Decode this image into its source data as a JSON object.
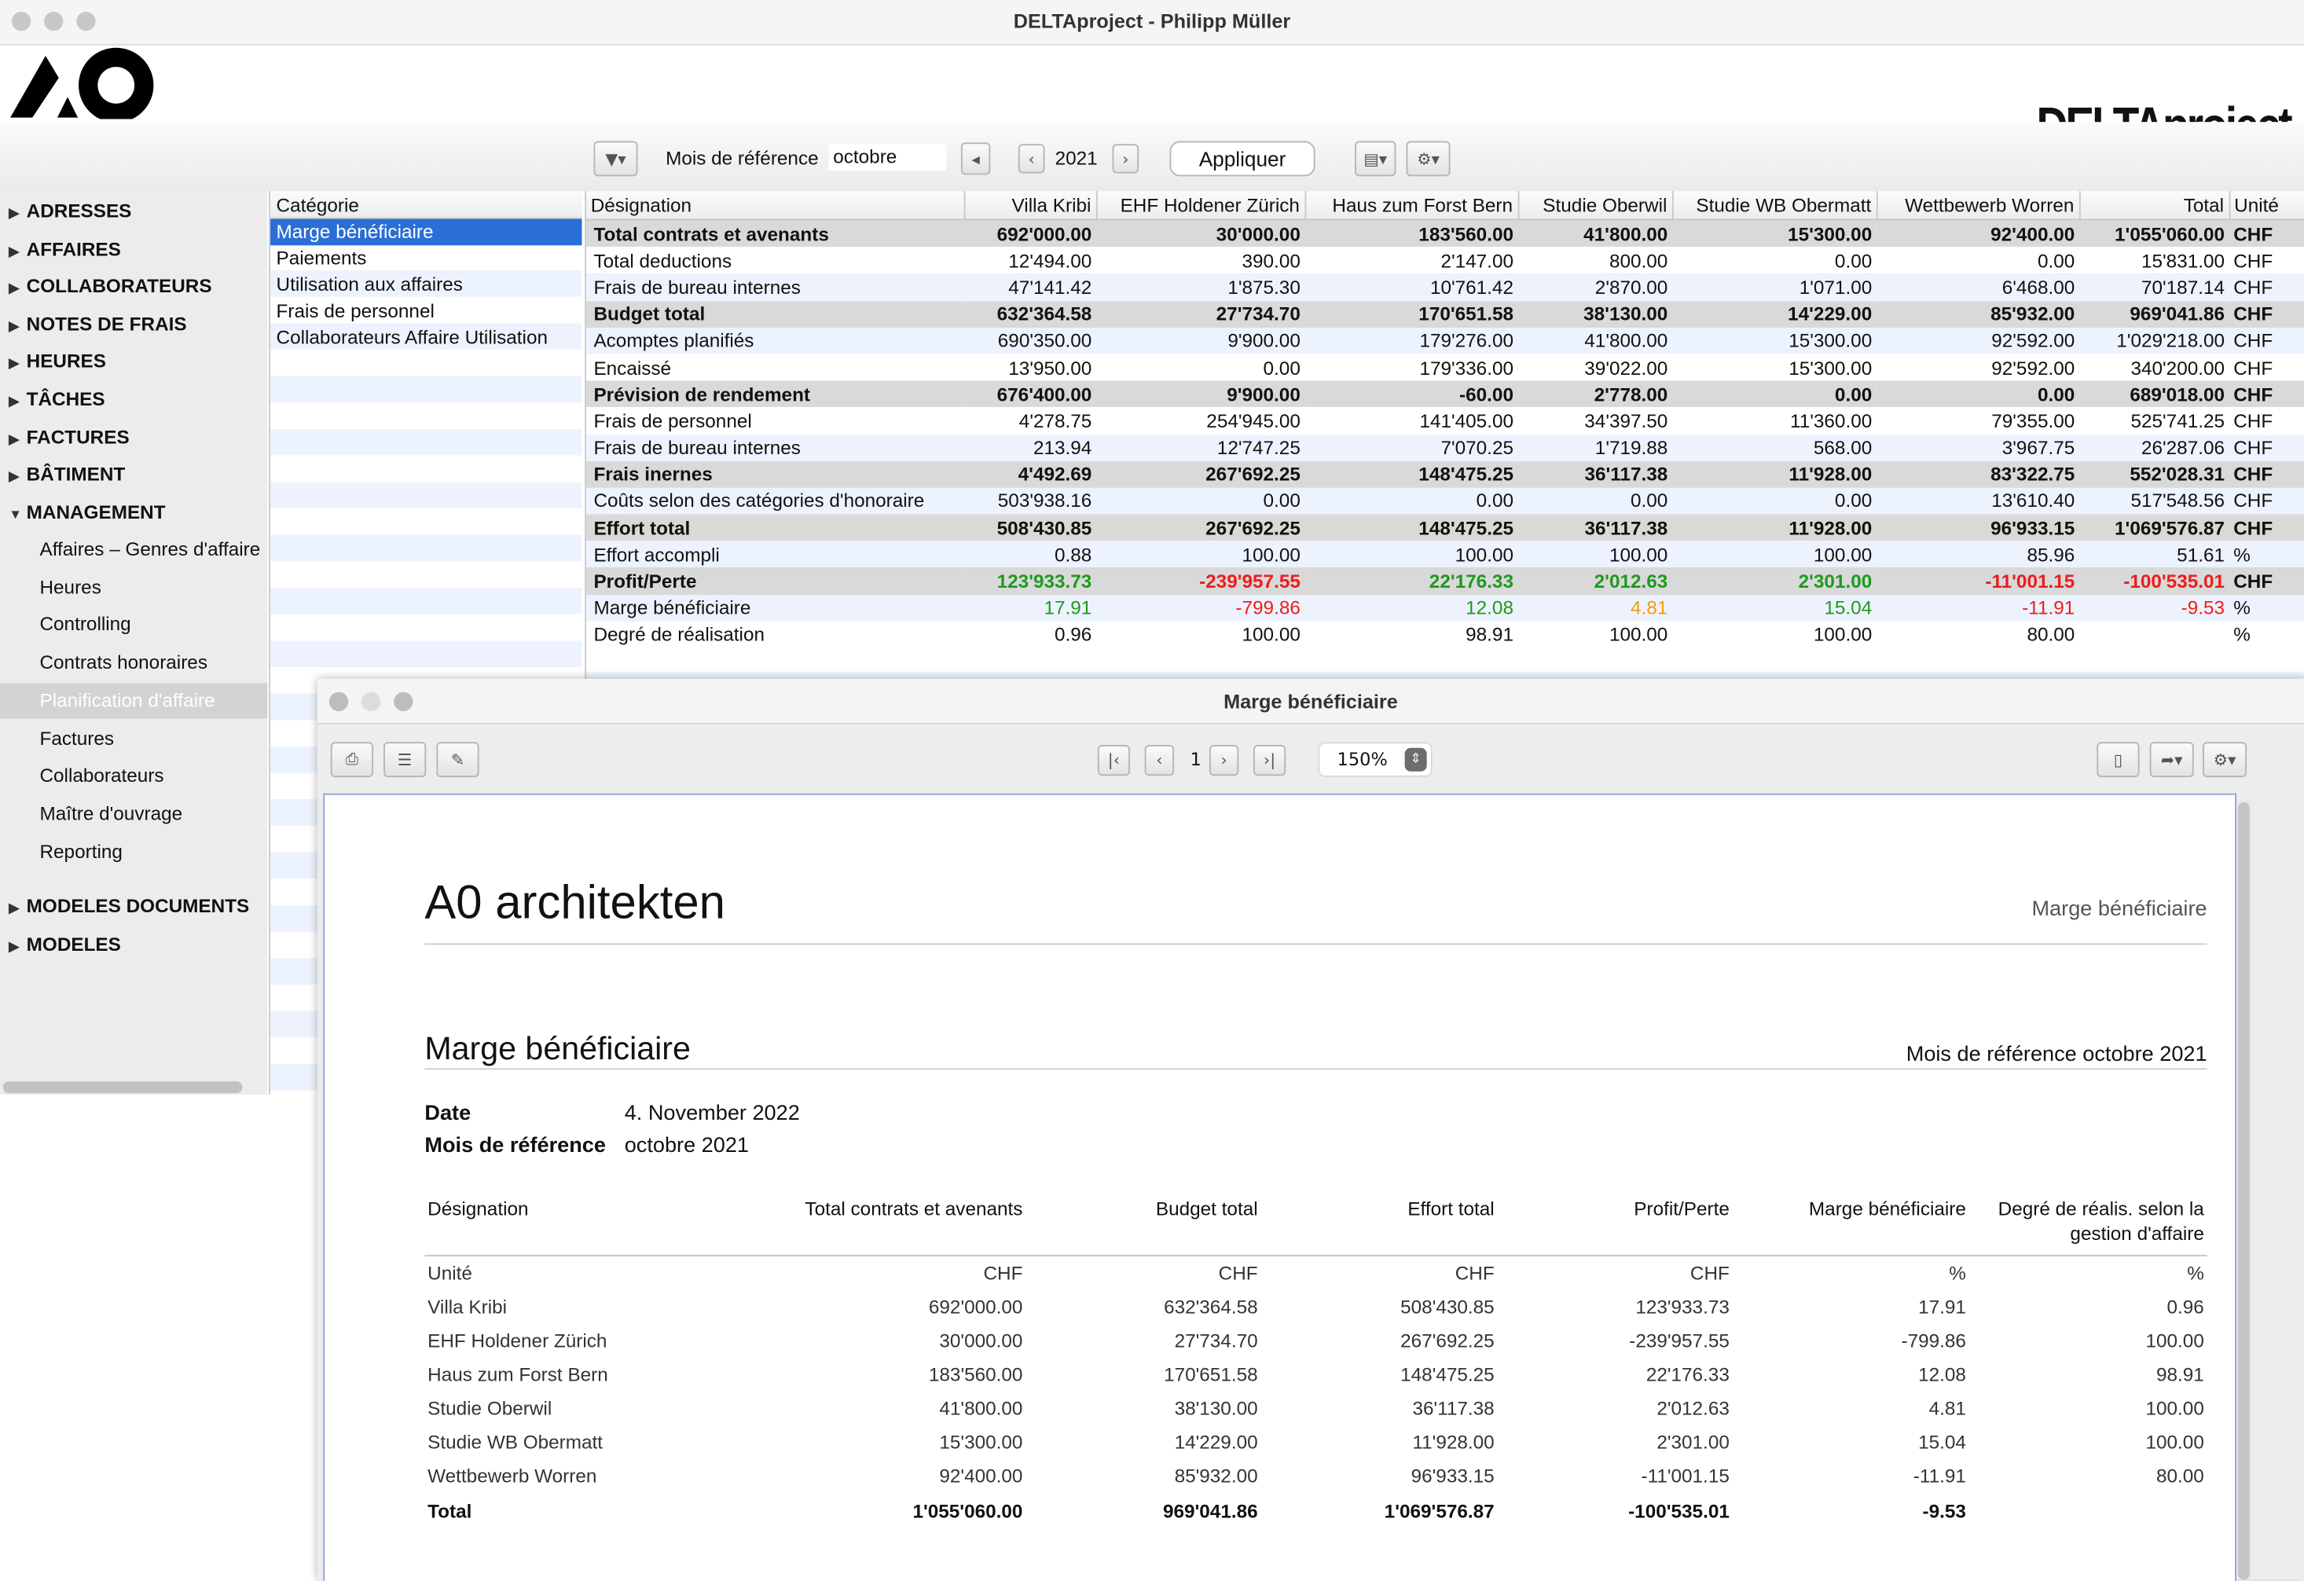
{
  "window": {
    "title": "DELTAproject - Philipp Müller",
    "brand": "DELTAproject",
    "logo": "A0"
  },
  "toolbar": {
    "filter_icon": "filter-icon",
    "ref_month_label": "Mois de référence",
    "ref_month_value": "octobre",
    "year": "2021",
    "apply_label": "Appliquer",
    "doc_icon": "document-icon",
    "gear_icon": "gear-icon"
  },
  "sidebar": {
    "top_items": [
      "ADRESSES",
      "AFFAIRES",
      "COLLABORATEURS",
      "NOTES DE FRAIS",
      "HEURES",
      "TÂCHES",
      "FACTURES",
      "BÂTIMENT"
    ],
    "expanded": "MANAGEMENT",
    "sub_items": [
      "Affaires – Genres d'affaire",
      "Heures",
      "Controlling",
      "Contrats honoraires",
      "Planification d'affaire",
      "Factures",
      "Collaborateurs",
      "Maître d'ouvrage",
      "Reporting"
    ],
    "selected_sub": "Planification d'affaire",
    "bottom_items": [
      "MODELES DOCUMENTS",
      "MODELES"
    ]
  },
  "categories": {
    "header": "Catégorie",
    "items": [
      "Marge bénéficiaire",
      "Paiements",
      "Utilisation aux affaires",
      "Frais de personnel",
      "Collaborateurs Affaire Utilisation"
    ],
    "selected": "Marge bénéficiaire"
  },
  "main_table": {
    "columns": [
      "Désignation",
      "Villa Kribi",
      "EHF Holdener Zürich",
      "Haus zum Forst Bern",
      "Studie Oberwil",
      "Studie WB Obermatt",
      "Wettbewerb Worren",
      "Total",
      "Unité"
    ],
    "rows": [
      {
        "bold": true,
        "cells": [
          "Total contrats et avenants",
          "692'000.00",
          "30'000.00",
          "183'560.00",
          "41'800.00",
          "15'300.00",
          "92'400.00",
          "1'055'060.00",
          "CHF"
        ]
      },
      {
        "cells": [
          "Total deductions",
          "12'494.00",
          "390.00",
          "2'147.00",
          "800.00",
          "0.00",
          "0.00",
          "15'831.00",
          "CHF"
        ]
      },
      {
        "cells": [
          "Frais de bureau internes",
          "47'141.42",
          "1'875.30",
          "10'761.42",
          "2'870.00",
          "1'071.00",
          "6'468.00",
          "70'187.14",
          "CHF"
        ]
      },
      {
        "bold": true,
        "cells": [
          "Budget total",
          "632'364.58",
          "27'734.70",
          "170'651.58",
          "38'130.00",
          "14'229.00",
          "85'932.00",
          "969'041.86",
          "CHF"
        ]
      },
      {
        "cells": [
          "Acomptes planifiés",
          "690'350.00",
          "9'900.00",
          "179'276.00",
          "41'800.00",
          "15'300.00",
          "92'592.00",
          "1'029'218.00",
          "CHF"
        ]
      },
      {
        "cells": [
          "Encaissé",
          "13'950.00",
          "0.00",
          "179'336.00",
          "39'022.00",
          "15'300.00",
          "92'592.00",
          "340'200.00",
          "CHF"
        ]
      },
      {
        "bold": true,
        "cells": [
          "Prévision de rendement",
          "676'400.00",
          "9'900.00",
          "-60.00",
          "2'778.00",
          "0.00",
          "0.00",
          "689'018.00",
          "CHF"
        ]
      },
      {
        "cells": [
          "Frais de personnel",
          "4'278.75",
          "254'945.00",
          "141'405.00",
          "34'397.50",
          "11'360.00",
          "79'355.00",
          "525'741.25",
          "CHF"
        ]
      },
      {
        "cells": [
          "Frais de bureau internes",
          "213.94",
          "12'747.25",
          "7'070.25",
          "1'719.88",
          "568.00",
          "3'967.75",
          "26'287.06",
          "CHF"
        ]
      },
      {
        "bold": true,
        "cells": [
          "Frais inernes",
          "4'492.69",
          "267'692.25",
          "148'475.25",
          "36'117.38",
          "11'928.00",
          "83'322.75",
          "552'028.31",
          "CHF"
        ]
      },
      {
        "cells": [
          "Coûts selon des catégories d'honoraire",
          "503'938.16",
          "0.00",
          "0.00",
          "0.00",
          "0.00",
          "13'610.40",
          "517'548.56",
          "CHF"
        ]
      },
      {
        "bold": true,
        "cells": [
          "Effort total",
          "508'430.85",
          "267'692.25",
          "148'475.25",
          "36'117.38",
          "11'928.00",
          "96'933.15",
          "1'069'576.87",
          "CHF"
        ]
      },
      {
        "cells": [
          "Effort accompli",
          "0.88",
          "100.00",
          "100.00",
          "100.00",
          "100.00",
          "85.96",
          "51.61",
          "%"
        ]
      },
      {
        "bold": true,
        "colors": [
          "",
          "pos",
          "neg",
          "pos",
          "pos",
          "pos",
          "neg",
          "neg",
          ""
        ],
        "cells": [
          "Profit/Perte",
          "123'933.73",
          "-239'957.55",
          "22'176.33",
          "2'012.63",
          "2'301.00",
          "-11'001.15",
          "-100'535.01",
          "CHF"
        ]
      },
      {
        "colors": [
          "",
          "pos",
          "neg",
          "pos",
          "warn",
          "pos",
          "neg",
          "neg",
          ""
        ],
        "cells": [
          "Marge bénéficiaire",
          "17.91",
          "-799.86",
          "12.08",
          "4.81",
          "15.04",
          "-11.91",
          "-9.53",
          "%"
        ]
      },
      {
        "cells": [
          "Degré de réalisation",
          "0.96",
          "100.00",
          "98.91",
          "100.00",
          "100.00",
          "80.00",
          "",
          "%"
        ]
      }
    ]
  },
  "colors": {
    "pos": "#1e9a1e",
    "neg": "#ee1c1c",
    "warn": "#f39c12",
    "selection": "#2b6fd6"
  },
  "preview": {
    "title": "Marge bénéficiaire",
    "page": "1",
    "zoom": "150%",
    "icons": [
      "print-icon",
      "settings-sliders-icon",
      "edit-icon",
      "first-page-icon",
      "prev-page-icon",
      "next-page-icon",
      "last-page-icon",
      "pdf-icon",
      "share-icon",
      "gear-icon"
    ],
    "report": {
      "company": "A0 architekten",
      "header_right": "Marge bénéficiaire",
      "heading": "Marge bénéficiaire",
      "heading_right": "Mois de référence octobre 2021",
      "date_label": "Date",
      "date_value": "4. November 2022",
      "ref_label": "Mois de référence",
      "ref_value": "octobre 2021",
      "columns": [
        "Désignation",
        "Total contrats et avenants",
        "Budget total",
        "Effort total",
        "Profit/Perte",
        "Marge bénéficiaire",
        "Degré de réalis. selon la gestion d'affaire"
      ],
      "rows": [
        [
          "Unité",
          "CHF",
          "CHF",
          "CHF",
          "CHF",
          "%",
          "%"
        ],
        [
          "Villa Kribi",
          "692'000.00",
          "632'364.58",
          "508'430.85",
          "123'933.73",
          "17.91",
          "0.96"
        ],
        [
          "EHF Holdener Zürich",
          "30'000.00",
          "27'734.70",
          "267'692.25",
          "-239'957.55",
          "-799.86",
          "100.00"
        ],
        [
          "Haus zum Forst Bern",
          "183'560.00",
          "170'651.58",
          "148'475.25",
          "22'176.33",
          "12.08",
          "98.91"
        ],
        [
          "Studie Oberwil",
          "41'800.00",
          "38'130.00",
          "36'117.38",
          "2'012.63",
          "4.81",
          "100.00"
        ],
        [
          "Studie WB Obermatt",
          "15'300.00",
          "14'229.00",
          "11'928.00",
          "2'301.00",
          "15.04",
          "100.00"
        ],
        [
          "Wettbewerb Worren",
          "92'400.00",
          "85'932.00",
          "96'933.15",
          "-11'001.15",
          "-11.91",
          "80.00"
        ]
      ],
      "total": [
        "Total",
        "1'055'060.00",
        "969'041.86",
        "1'069'576.87",
        "-100'535.01",
        "-9.53",
        ""
      ]
    }
  }
}
